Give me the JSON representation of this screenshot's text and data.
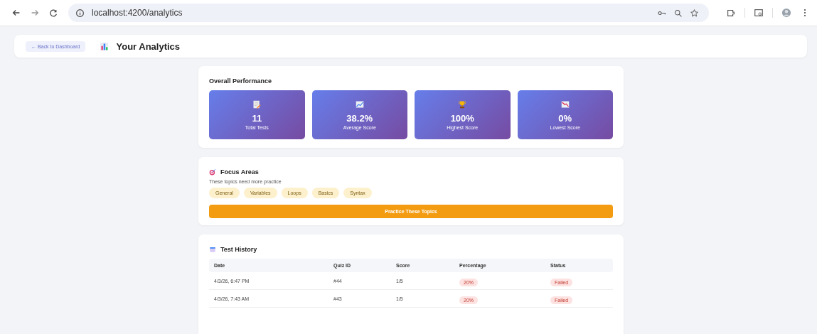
{
  "browser": {
    "url": "localhost:4200/analytics"
  },
  "header": {
    "back_button": "← Back to Dashboard",
    "title": "Your Analytics"
  },
  "overall": {
    "title": "Overall Performance",
    "stats": [
      {
        "value": "11",
        "label": "Total Tests"
      },
      {
        "value": "38.2%",
        "label": "Average Score"
      },
      {
        "value": "100%",
        "label": "Highest Score"
      },
      {
        "value": "0%",
        "label": "Lowest Score"
      }
    ]
  },
  "focus": {
    "title": "Focus Areas",
    "subtitle": "These topics need more practice",
    "topics": [
      "General",
      "Variables",
      "Loops",
      "Basics",
      "Syntax"
    ],
    "button": "Practice These Topics"
  },
  "history": {
    "title": "Test History",
    "columns": [
      "Date",
      "Quiz ID",
      "Score",
      "Percentage",
      "Status"
    ],
    "rows": [
      {
        "date": "4/3/26, 6:47 PM",
        "quiz_id": "#44",
        "score": "1/5",
        "percentage": "20%",
        "status": "Failed",
        "kind": "failed"
      },
      {
        "date": "4/3/26, 7:43 AM",
        "quiz_id": "#43",
        "score": "1/5",
        "percentage": "20%",
        "status": "Failed",
        "kind": "failed"
      }
    ]
  }
}
